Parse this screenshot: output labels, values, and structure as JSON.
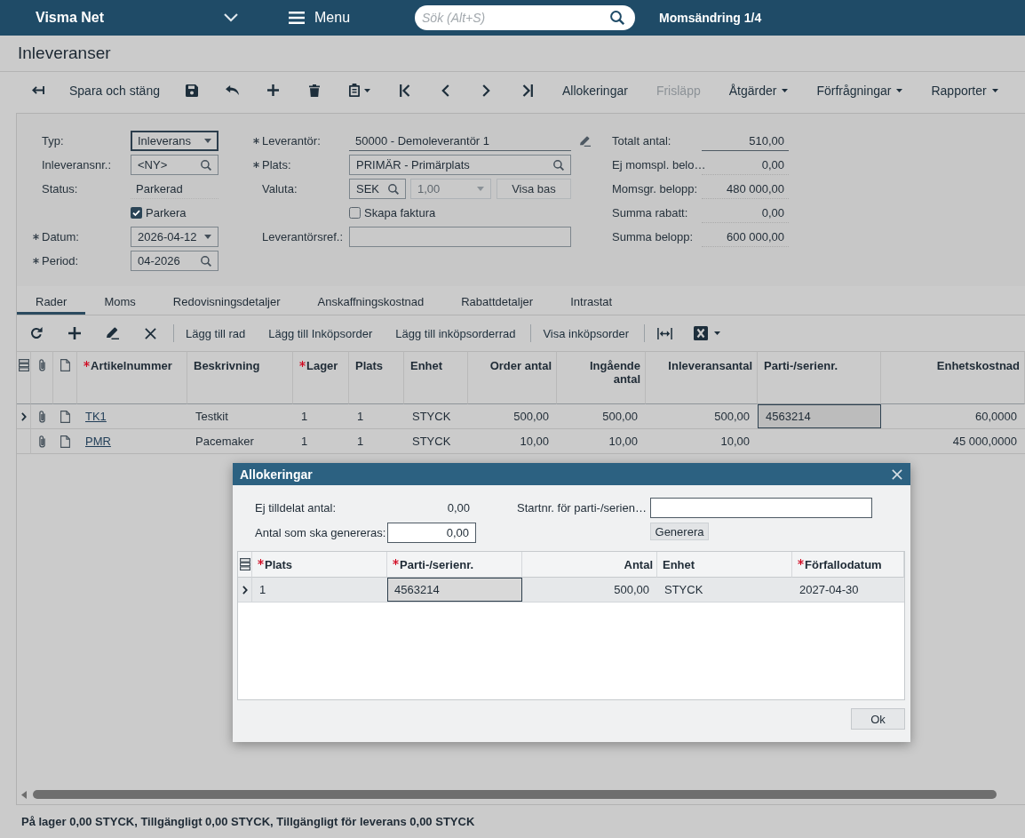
{
  "topbar": {
    "brand": "Visma Net",
    "menu": "Menu",
    "search": {
      "placeholder": "Sök (Alt+S)"
    },
    "context": "Momsändring 1/4"
  },
  "page": {
    "title": "Inleveranser"
  },
  "toolbar": {
    "save_close": "Spara och stäng",
    "actions": [
      {
        "label": "Allokeringar",
        "disabled": false,
        "dropdown": false
      },
      {
        "label": "Frisläpp",
        "disabled": true,
        "dropdown": false
      },
      {
        "label": "Åtgärder",
        "disabled": false,
        "dropdown": true
      },
      {
        "label": "Förfrågningar",
        "disabled": false,
        "dropdown": true
      },
      {
        "label": "Rapporter",
        "disabled": false,
        "dropdown": true
      }
    ]
  },
  "form": {
    "left": [
      {
        "kind": "select",
        "label": "Typ:",
        "required": false,
        "focused": true,
        "value": "Inleverans"
      },
      {
        "kind": "lookup",
        "label": "Inleveransnr.:",
        "required": false,
        "focused": false,
        "value": "<NY>"
      },
      {
        "kind": "text",
        "label": "Status:",
        "required": false,
        "focused": false,
        "value": "Parkerad"
      },
      {
        "kind": "checkbox",
        "label": "Parkera",
        "checked": true
      },
      {
        "kind": "date",
        "label": "Datum:",
        "required": true,
        "focused": false,
        "value": "2026-04-12"
      },
      {
        "kind": "lookup",
        "label": "Period:",
        "required": true,
        "focused": false,
        "value": "04-2026"
      }
    ],
    "middle": [
      {
        "kind": "display",
        "label": "Leverantör:",
        "required": true,
        "focused": false,
        "value": "50000 - Demoleverantör 1"
      },
      {
        "kind": "lookup",
        "label": "Plats:",
        "required": true,
        "focused": false,
        "value": "PRIMÄR - Primärplats"
      },
      {
        "kind": "currency",
        "label": "Valuta:",
        "required": false,
        "focused": false,
        "value": "SEK",
        "rate": "1,00",
        "rate_disabled": true,
        "button": "Visa bas"
      },
      {
        "kind": "checkbox",
        "label": "Skapa faktura",
        "checked": false
      },
      {
        "kind": "input",
        "label": "Leverantörsref.:",
        "required": false,
        "focused": false
      }
    ],
    "totals": [
      {
        "kind": "input",
        "label": "Totalt antal:",
        "value": "510,00"
      },
      {
        "kind": "readonly",
        "label": "Ej momspl. belo…",
        "value": "0,00"
      },
      {
        "kind": "readonly",
        "label": "Momsgr. belopp:",
        "value": "480 000,00"
      },
      {
        "kind": "readonly",
        "label": "Summa rabatt:",
        "value": "0,00"
      },
      {
        "kind": "readonly",
        "label": "Summa belopp:",
        "value": "600 000,00"
      }
    ]
  },
  "tabs": [
    {
      "label": "Rader",
      "selected": true
    },
    {
      "label": "Moms",
      "selected": false
    },
    {
      "label": "Redovisningsdetaljer",
      "selected": false
    },
    {
      "label": "Anskaffningskostnad",
      "selected": false
    },
    {
      "label": "Rabattdetaljer",
      "selected": false
    },
    {
      "label": "Intrastat",
      "selected": false
    }
  ],
  "grid_toolbar": {
    "groups": [
      [
        "Lägg till rad",
        "Lägg till Inköpsorder",
        "Lägg till inköpsorderrad"
      ],
      [
        "Visa inköpsorder"
      ]
    ]
  },
  "grid": {
    "columns": [
      {
        "label": "Artikelnummer",
        "required": true
      },
      {
        "label": "Beskrivning",
        "required": false
      },
      {
        "label": "Lager",
        "required": true
      },
      {
        "label": "Plats",
        "required": false
      },
      {
        "label": "Enhet",
        "required": false
      },
      {
        "label": "Order antal",
        "required": false
      },
      {
        "label": "Ingående antal",
        "required": false
      },
      {
        "label": "Inleveransantal",
        "required": false
      },
      {
        "label": "Parti-/serienr.",
        "required": false
      },
      {
        "label": "Enhetskostnad",
        "required": false
      }
    ],
    "rows": [
      {
        "current": true,
        "item": "TK1",
        "description": "Testkit",
        "warehouse": "1",
        "location": "1",
        "unit": "STYCK",
        "order_qty": "500,00",
        "incoming_qty": "500,00",
        "received_qty": "500,00",
        "lot_serial": "4563214",
        "lot_serial_focused": true,
        "unit_cost": "60,0000"
      },
      {
        "current": false,
        "item": "PMR",
        "description": "Pacemaker",
        "warehouse": "1",
        "location": "1",
        "unit": "STYCK",
        "order_qty": "10,00",
        "incoming_qty": "10,00",
        "received_qty": "10,00",
        "lot_serial_focused": false,
        "unit_cost": "45 000,0000"
      }
    ]
  },
  "dialog": {
    "title": "Allokeringar",
    "unassigned": {
      "label": "Ej tilldelat antal:",
      "value": "0,00"
    },
    "to_generate": {
      "label": "Antal som ska genereras:",
      "value": "0,00"
    },
    "start_number": {
      "label": "Startnr. för parti-/serien…"
    },
    "generate_button": "Generera",
    "grid": {
      "columns": [
        {
          "label": "Plats",
          "required": true
        },
        {
          "label": "Parti-/serienr.",
          "required": true
        },
        {
          "label": "Antal",
          "required": false
        },
        {
          "label": "Enhet",
          "required": false
        },
        {
          "label": "Förfallodatum",
          "required": true
        }
      ],
      "rows": [
        {
          "current": true,
          "location": "1",
          "lot_serial": "4563214",
          "lot_serial_focused": true,
          "quantity": "500,00",
          "unit": "STYCK",
          "expiry": "2027-04-30"
        }
      ]
    },
    "ok_button": "Ok"
  },
  "status_bar": {
    "text": "På lager 0,00 STYCK, Tillgängligt 0,00 STYCK, Tillgängligt för leverans 0,00 STYCK"
  }
}
